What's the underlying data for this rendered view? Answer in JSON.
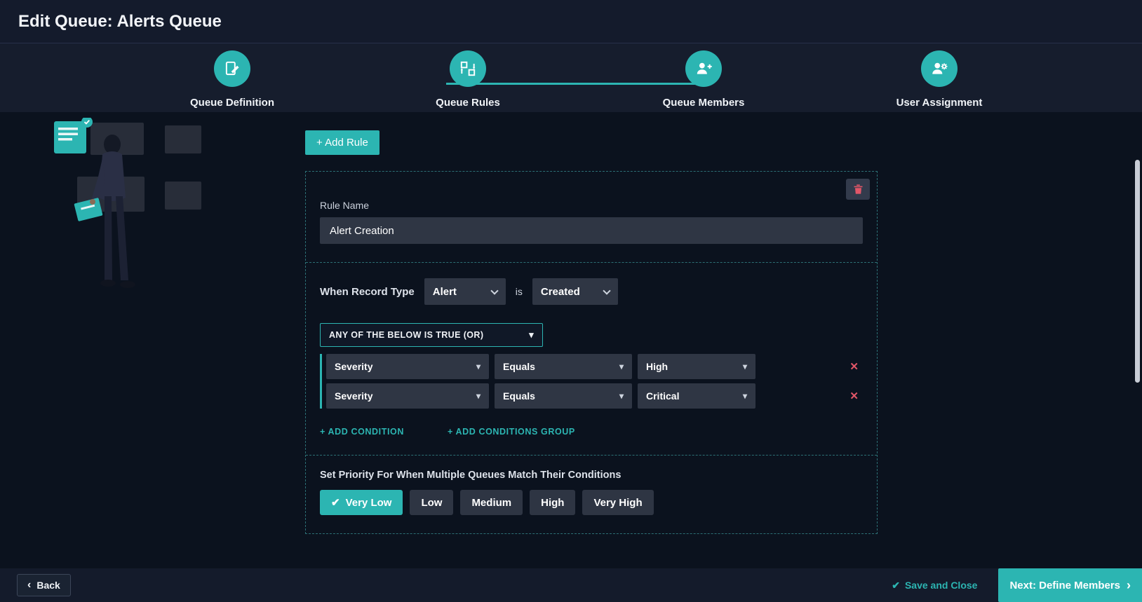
{
  "window": {
    "title": "Edit Queue: Alerts Queue"
  },
  "stepper": {
    "steps": [
      {
        "label": "Queue Definition",
        "icon": "document-edit-icon"
      },
      {
        "label": "Queue Rules",
        "icon": "swap-boxes-icon"
      },
      {
        "label": "Queue Members",
        "icon": "person-add-icon"
      },
      {
        "label": "User Assignment",
        "icon": "person-gear-icon"
      }
    ]
  },
  "toolbar": {
    "add_rule_label": "+ Add Rule"
  },
  "rule": {
    "rule_name_label": "Rule Name",
    "rule_name_value": "Alert Creation",
    "when_record_type_label": "When Record Type",
    "record_type_value": "Alert",
    "is_label": "is",
    "event_value": "Created",
    "group_operator": "ANY OF THE BELOW IS TRUE (OR)",
    "conditions": [
      {
        "field": "Severity",
        "operator": "Equals",
        "value": "High"
      },
      {
        "field": "Severity",
        "operator": "Equals",
        "value": "Critical"
      }
    ],
    "add_condition_label": "+ ADD CONDITION",
    "add_conditions_group_label": "+ ADD CONDITIONS GROUP",
    "priority_label": "Set Priority For When Multiple Queues Match Their Conditions",
    "priority_options": [
      {
        "label": "Very Low",
        "selected": true
      },
      {
        "label": "Low",
        "selected": false
      },
      {
        "label": "Medium",
        "selected": false
      },
      {
        "label": "High",
        "selected": false
      },
      {
        "label": "Very High",
        "selected": false
      }
    ]
  },
  "footer": {
    "back_label": "Back",
    "save_and_close_label": "Save and Close",
    "next_label": "Next: Define Members"
  },
  "icons": {
    "check": "✔",
    "close": "✕",
    "triangle_down": "▾",
    "chevron_left": "‹",
    "chevron_right": "›"
  },
  "colors": {
    "accent": "#2cb5b2",
    "danger": "#e25668",
    "header_bg": "#141b2c",
    "panel_dashed_border": "#2c6f75"
  }
}
